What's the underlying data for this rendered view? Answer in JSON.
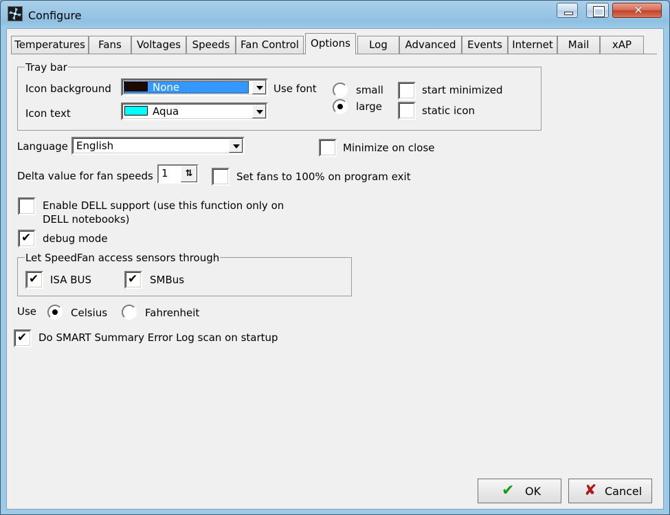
{
  "window": {
    "title": "Configure"
  },
  "tabs": [
    {
      "label": "Temperatures"
    },
    {
      "label": "Fans"
    },
    {
      "label": "Voltages"
    },
    {
      "label": "Speeds"
    },
    {
      "label": "Fan Control"
    },
    {
      "label": "Options",
      "active": true
    },
    {
      "label": "Log"
    },
    {
      "label": "Advanced"
    },
    {
      "label": "Events"
    },
    {
      "label": "Internet"
    },
    {
      "label": "Mail"
    },
    {
      "label": "xAP"
    }
  ],
  "traybar": {
    "title": "Tray bar",
    "icon_background_label": "Icon background",
    "icon_background_value": "None",
    "icon_background_color": "#1a0a00",
    "icon_text_label": "Icon text",
    "icon_text_value": "Aqua",
    "icon_text_color": "#00ffff",
    "use_font_label": "Use font",
    "font_small_label": "small",
    "font_large_label": "large",
    "font_selected": "large",
    "start_minimized_label": "start minimized",
    "start_minimized_checked": false,
    "static_icon_label": "static icon",
    "static_icon_checked": false
  },
  "language": {
    "label": "Language",
    "value": "English"
  },
  "minimize_on_close": {
    "label": "Minimize on close",
    "checked": false
  },
  "delta": {
    "label": "Delta value for fan speeds",
    "value": "1"
  },
  "set_fans_100": {
    "label": "Set fans to 100% on program exit",
    "checked": false
  },
  "dell": {
    "label_line1": "Enable DELL support (use this function only on",
    "label_line2": "DELL notebooks)",
    "checked": false
  },
  "debug": {
    "label": "debug mode",
    "checked": true
  },
  "sensors": {
    "title": "Let SpeedFan access sensors through",
    "isa_label": "ISA BUS",
    "isa_checked": true,
    "smbus_label": "SMBus",
    "smbus_checked": true
  },
  "units": {
    "use_label": "Use",
    "celsius_label": "Celsius",
    "fahrenheit_label": "Fahrenheit",
    "selected": "Celsius"
  },
  "smart": {
    "label": "Do SMART Summary Error Log scan on startup",
    "checked": true
  },
  "buttons": {
    "ok_label": "OK",
    "cancel_label": "Cancel"
  },
  "colors": {
    "accent_selection": "#3399ff",
    "ok_green": "#1a9a1a",
    "cancel_red": "#b01818"
  }
}
